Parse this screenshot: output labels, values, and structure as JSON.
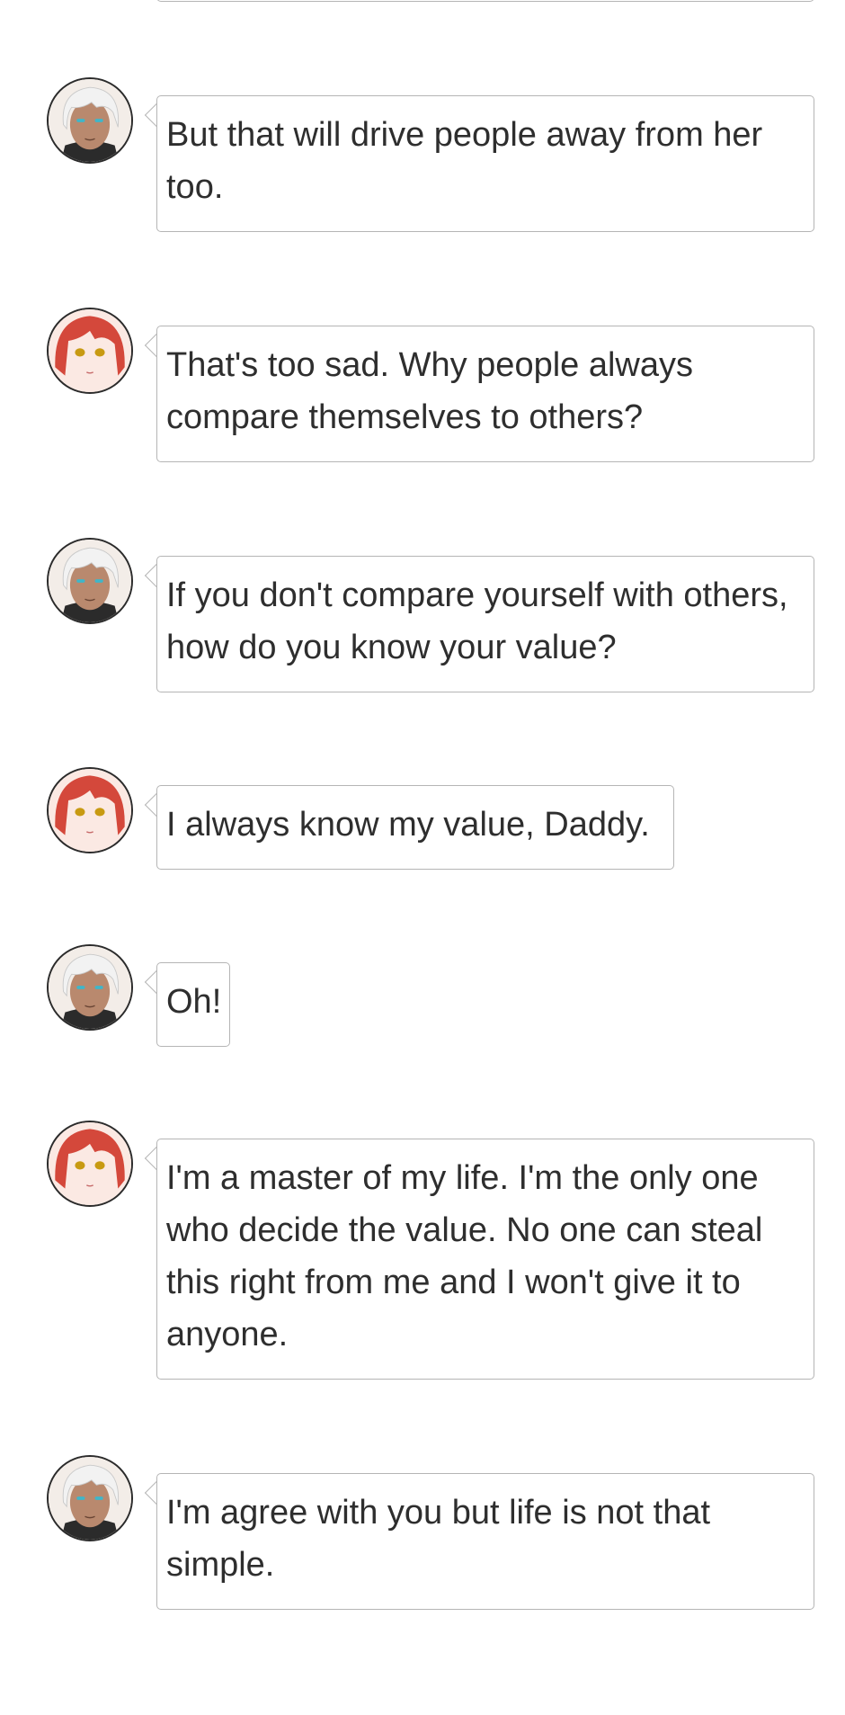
{
  "messages": [
    {
      "speaker": "father",
      "text": "But that will drive people away from her too."
    },
    {
      "speaker": "daughter",
      "text": "That's too sad. Why people always compare themselves to others?"
    },
    {
      "speaker": "father",
      "text": "If you don't compare yourself with others, how do you know your value?"
    },
    {
      "speaker": "daughter",
      "text": "I always know my value, Daddy."
    },
    {
      "speaker": "father",
      "text": "Oh!"
    },
    {
      "speaker": "daughter",
      "text": "I'm a master of my life. I'm the only one who decide the value. No one can steal this right from me and I won't give it to anyone."
    },
    {
      "speaker": "father",
      "text": "I'm agree with you but life is not that simple."
    }
  ],
  "colors": {
    "bubble_border": "#b5b5b5",
    "text": "#2e2e2e",
    "father_hair": "#f2f2f2",
    "father_skin": "#b9896e",
    "father_eyes": "#3fb6c9",
    "daughter_hair": "#d4483b",
    "daughter_skin": "#fbe9e3",
    "daughter_eyes": "#c89a12"
  }
}
